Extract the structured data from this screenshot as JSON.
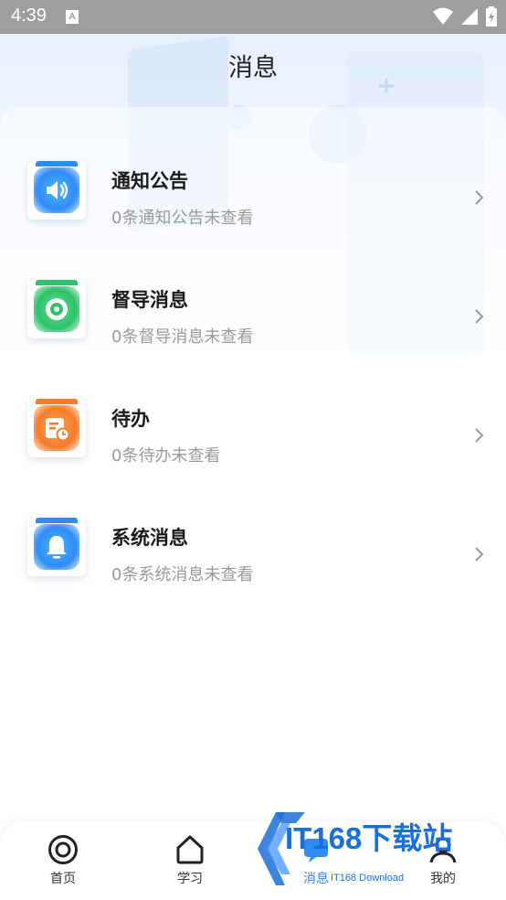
{
  "status_bar": {
    "time": "4:39",
    "notif_letter": "A"
  },
  "header": {
    "title": "消息"
  },
  "messages": [
    {
      "title": "通知公告",
      "subtitle": "0条通知公告未查看",
      "icon": "speaker-icon",
      "color": "#2f8cf4"
    },
    {
      "title": "督导消息",
      "subtitle": "0条督导消息未查看",
      "icon": "eye-icon",
      "color": "#2ec26a"
    },
    {
      "title": "待办",
      "subtitle": "0条待办未查看",
      "icon": "todo-icon",
      "color": "#f47c2a"
    },
    {
      "title": "系统消息",
      "subtitle": "0条系统消息未查看",
      "icon": "bell-icon",
      "color": "#2f8cf4"
    }
  ],
  "tabbar": {
    "items": [
      {
        "label": "首页",
        "icon": "home-target-icon"
      },
      {
        "label": "学习",
        "icon": "house-icon"
      },
      {
        "label": "消息",
        "icon": "message-icon"
      },
      {
        "label": "我的",
        "icon": "profile-icon"
      }
    ]
  },
  "watermark": {
    "text": "IT168下载站",
    "sub": "IT168 Download"
  }
}
